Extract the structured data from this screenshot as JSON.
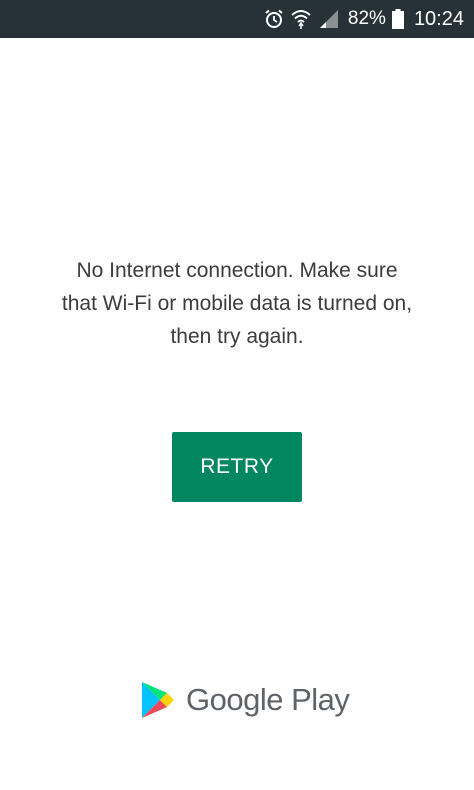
{
  "status_bar": {
    "icons": [
      "alarm-icon",
      "wifi-icon",
      "cell-signal-icon",
      "battery-icon"
    ],
    "battery": "82%",
    "time": "10:24",
    "background": "#263238"
  },
  "message": {
    "text": "No Internet connection. Make sure\nthat Wi-Fi or mobile data is turned on,\nthen try again."
  },
  "retry_button": {
    "label": "RETRY",
    "color": "#01875f"
  },
  "brand": {
    "text": "Google Play",
    "logo": "google-play-logo"
  }
}
